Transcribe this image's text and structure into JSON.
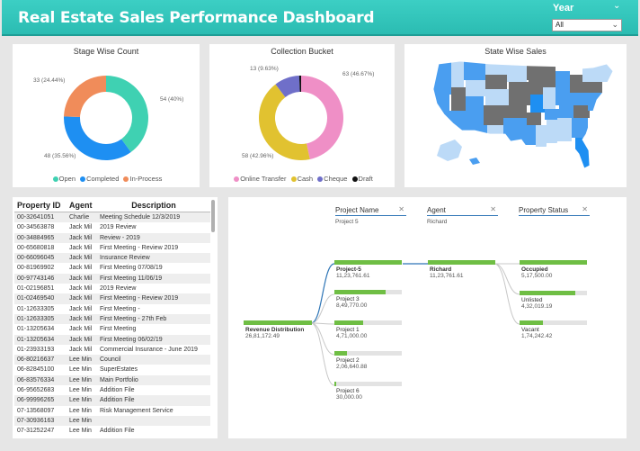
{
  "header": {
    "title": "Real Estate Sales Performance Dashboard",
    "year_label": "Year",
    "year_value": "All",
    "bg_color": "#2bbcb2"
  },
  "stage_chart": {
    "title": "Stage Wise Count",
    "labels": [
      "33 (24.44%)",
      "54 (40%)",
      "48 (35.56%)"
    ],
    "legend": [
      {
        "name": "Open",
        "color": "#3fd1b2"
      },
      {
        "name": "Completed",
        "color": "#1e8ff2"
      },
      {
        "name": "In-Process",
        "color": "#f08c5a"
      }
    ]
  },
  "collection_chart": {
    "title": "Collection Bucket",
    "labels": [
      "13 (9.63%)",
      "63 (46.67%)",
      "58 (42.96%)"
    ],
    "legend": [
      {
        "name": "Online Transfer",
        "color": "#ef8fc6"
      },
      {
        "name": "Cash",
        "color": "#e1c230"
      },
      {
        "name": "Cheque",
        "color": "#6f6fc9"
      },
      {
        "name": "Draft",
        "color": "#111111"
      }
    ]
  },
  "chart_data": [
    {
      "type": "pie",
      "title": "Stage Wise Count",
      "categories": [
        "Open",
        "Completed",
        "In-Process"
      ],
      "values": [
        54,
        48,
        33
      ],
      "percent": [
        40,
        35.56,
        24.44
      ]
    },
    {
      "type": "pie",
      "title": "Collection Bucket",
      "categories": [
        "Online Transfer",
        "Cash",
        "Cheque",
        "Draft"
      ],
      "values": [
        63,
        58,
        13,
        1
      ],
      "percent": [
        46.67,
        42.96,
        9.63,
        0.74
      ]
    }
  ],
  "map": {
    "title": "State Wise Sales",
    "colors": {
      "dark": "#707070",
      "mid": "#4a9ef0",
      "light": "#bcdaf7",
      "bright": "#1e8ff2"
    }
  },
  "table": {
    "headers": [
      "Property ID",
      "Agent",
      "Description"
    ],
    "rows": [
      [
        "00-32641051",
        "Charlie",
        "Meeting Schedule 12/3/2019"
      ],
      [
        "00-34563878",
        "Jack Mil",
        "2019 Review"
      ],
      [
        "00-34884965",
        "Jack Mil",
        "Review - 2019"
      ],
      [
        "00-65680818",
        "Jack Mil",
        "First Meeting - Review 2019"
      ],
      [
        "00-66096045",
        "Jack Mil",
        "Insurance Review"
      ],
      [
        "00-81969902",
        "Jack Mil",
        "First Meeting 07/08/19"
      ],
      [
        "00-97743146",
        "Jack Mil",
        "First Meeting 11/06/19"
      ],
      [
        "01-02196851",
        "Jack Mil",
        "2019 Review"
      ],
      [
        "01-02469540",
        "Jack Mil",
        "First Meeting - Review 2019"
      ],
      [
        "01-12633305",
        "Jack Mil",
        "First Meeting -"
      ],
      [
        "01-12633305",
        "Jack Mil",
        "First Meeting - 27th Feb"
      ],
      [
        "01-13205634",
        "Jack Mil",
        "First Meeting"
      ],
      [
        "01-13205634",
        "Jack Mil",
        "First Meeting 06/02/19"
      ],
      [
        "01-23933193",
        "Jack Mil",
        "Commercial Insurance - June 2019"
      ],
      [
        "06-80216637",
        "Lee Min",
        "Council"
      ],
      [
        "06-82845100",
        "Lee Min",
        "SuperEstates"
      ],
      [
        "06-83576334",
        "Lee Min",
        "Main Portfolio"
      ],
      [
        "06-95652683",
        "Lee Min",
        "Addition File"
      ],
      [
        "06-99996265",
        "Lee Min",
        "Addition File"
      ],
      [
        "07-13568097",
        "Lee Min",
        "Risk Management Service"
      ],
      [
        "07-30936163",
        "Lee Min",
        ""
      ],
      [
        "07-31252247",
        "Lee Min",
        "Addition File"
      ]
    ]
  },
  "decomp": {
    "filters": [
      {
        "title": "Project Name",
        "value": "Project 5"
      },
      {
        "title": "Agent",
        "value": "Richard"
      },
      {
        "title": "Property Status",
        "value": ""
      }
    ],
    "root": {
      "name": "Revenue Distribution",
      "value": "26,81,172.49"
    },
    "projects": [
      {
        "name": "Project-5",
        "value": "11,23,761.61",
        "fill": 1.0
      },
      {
        "name": "Project 3",
        "value": "8,49,770.00",
        "fill": 0.76
      },
      {
        "name": "Project 1",
        "value": "4,71,000.00",
        "fill": 0.42
      },
      {
        "name": "Project 2",
        "value": "2,06,640.88",
        "fill": 0.18
      },
      {
        "name": "Project 6",
        "value": "30,000.00",
        "fill": 0.03
      }
    ],
    "agent": {
      "name": "Richard",
      "value": "11,23,761.61",
      "fill": 1.0
    },
    "statuses": [
      {
        "name": "Occupied",
        "value": "5,17,500.00",
        "fill": 1.0
      },
      {
        "name": "Unlisted",
        "value": "4,32,019.19",
        "fill": 0.83
      },
      {
        "name": "Vacant",
        "value": "1,74,242.42",
        "fill": 0.34
      }
    ]
  }
}
